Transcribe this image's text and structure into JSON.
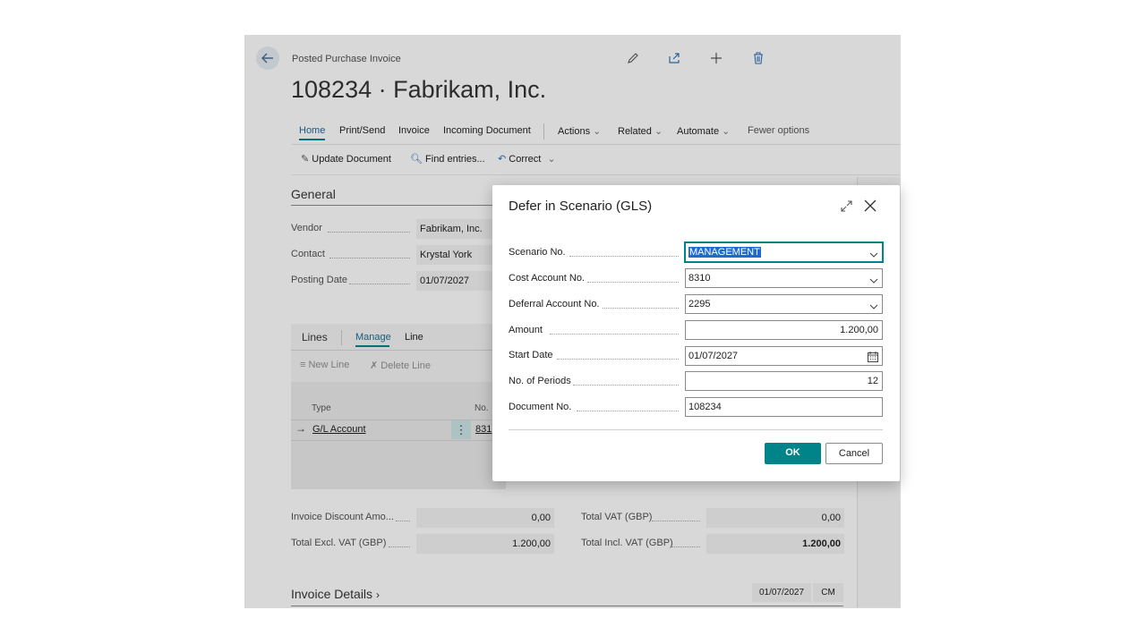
{
  "page": {
    "caption": "Posted Purchase Invoice",
    "title": "108234 · Fabrikam, Inc.",
    "header_icons": [
      "pencil-icon",
      "share-icon",
      "plus-icon",
      "trash-icon"
    ],
    "nav": {
      "items": [
        "Home",
        "Print/Send",
        "Invoice",
        "Incoming Document"
      ],
      "dropdowns": [
        "Actions",
        "Related",
        "Automate"
      ],
      "fewer_options": "Fewer options"
    },
    "actions": {
      "update_document": "Update Document",
      "find_entries": "Find entries...",
      "correct": "Correct"
    },
    "general": {
      "heading": "General",
      "fields": [
        {
          "label": "Vendor",
          "value": "Fabrikam, Inc."
        },
        {
          "label": "Contact",
          "value": "Krystal York"
        },
        {
          "label": "Posting Date",
          "value": "01/07/2027"
        }
      ]
    },
    "lines": {
      "tab": "Lines",
      "manage": "Manage",
      "line": "Line",
      "new_line": "New Line",
      "delete_line": "Delete Line",
      "col_type": "Type",
      "col_no": "No.",
      "row_type": "G/L Account",
      "row_no": "831"
    },
    "totals": {
      "invoice_discount_label": "Invoice Discount Amo...",
      "invoice_discount_value": "0,00",
      "total_excl_label": "Total Excl. VAT (GBP)",
      "total_excl_value": "1.200,00",
      "total_vat_label": "Total VAT (GBP)",
      "total_vat_value": "0,00",
      "total_incl_label": "Total Incl. VAT (GBP)",
      "total_incl_value": "1.200,00"
    },
    "invoice_details": {
      "heading": "Invoice Details",
      "date": "01/07/2027",
      "code": "CM"
    }
  },
  "dialog": {
    "title": "Defer in Scenario (GLS)",
    "fields": [
      {
        "label": "Scenario No.",
        "value": "MANAGEMENT"
      },
      {
        "label": "Cost Account No.",
        "value": "8310"
      },
      {
        "label": "Deferral Account No.",
        "value": "2295"
      },
      {
        "label": "Amount",
        "value": "1.200,00"
      },
      {
        "label": "Start Date",
        "value": "01/07/2027"
      },
      {
        "label": "No. of Periods",
        "value": "12"
      },
      {
        "label": "Document No.",
        "value": "108234"
      }
    ],
    "ok_label": "OK",
    "cancel_label": "Cancel"
  },
  "colors": {
    "accent": "#008489",
    "selection": "#1f6ad1"
  }
}
